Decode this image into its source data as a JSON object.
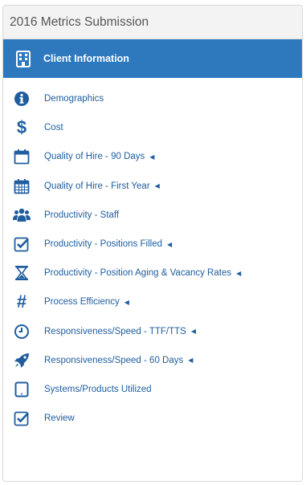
{
  "panel": {
    "title": "2016 Metrics Submission"
  },
  "active": {
    "label": "Client Information",
    "icon": "building-icon"
  },
  "menu": [
    {
      "label": "Demographics",
      "icon": "info-circle-icon",
      "has_caret": false
    },
    {
      "label": "Cost",
      "icon": "dollar-icon",
      "has_caret": false
    },
    {
      "label": "Quality of Hire - 90 Days",
      "icon": "calendar-empty-icon",
      "has_caret": true
    },
    {
      "label": "Quality of Hire - First Year",
      "icon": "calendar-icon",
      "has_caret": true
    },
    {
      "label": "Productivity - Staff",
      "icon": "users-icon",
      "has_caret": false
    },
    {
      "label": "Productivity - Positions Filled",
      "icon": "check-square-icon",
      "has_caret": true
    },
    {
      "label": "Productivity - Position Aging & Vacancy Rates",
      "icon": "hourglass-icon",
      "has_caret": true
    },
    {
      "label": "Process Efficiency",
      "icon": "hashtag-icon",
      "has_caret": true
    },
    {
      "label": "Responsiveness/Speed - TTF/TTS",
      "icon": "clock-icon",
      "has_caret": true
    },
    {
      "label": "Responsiveness/Speed - 60 Days",
      "icon": "rocket-icon",
      "has_caret": true
    },
    {
      "label": "Systems/Products Utilized",
      "icon": "tablet-icon",
      "has_caret": false
    },
    {
      "label": "Review",
      "icon": "check-square-icon",
      "has_caret": false
    }
  ],
  "colors": {
    "accent": "#2e78bd",
    "link": "#1f5d9e",
    "header_bg": "#f3f3f3"
  }
}
